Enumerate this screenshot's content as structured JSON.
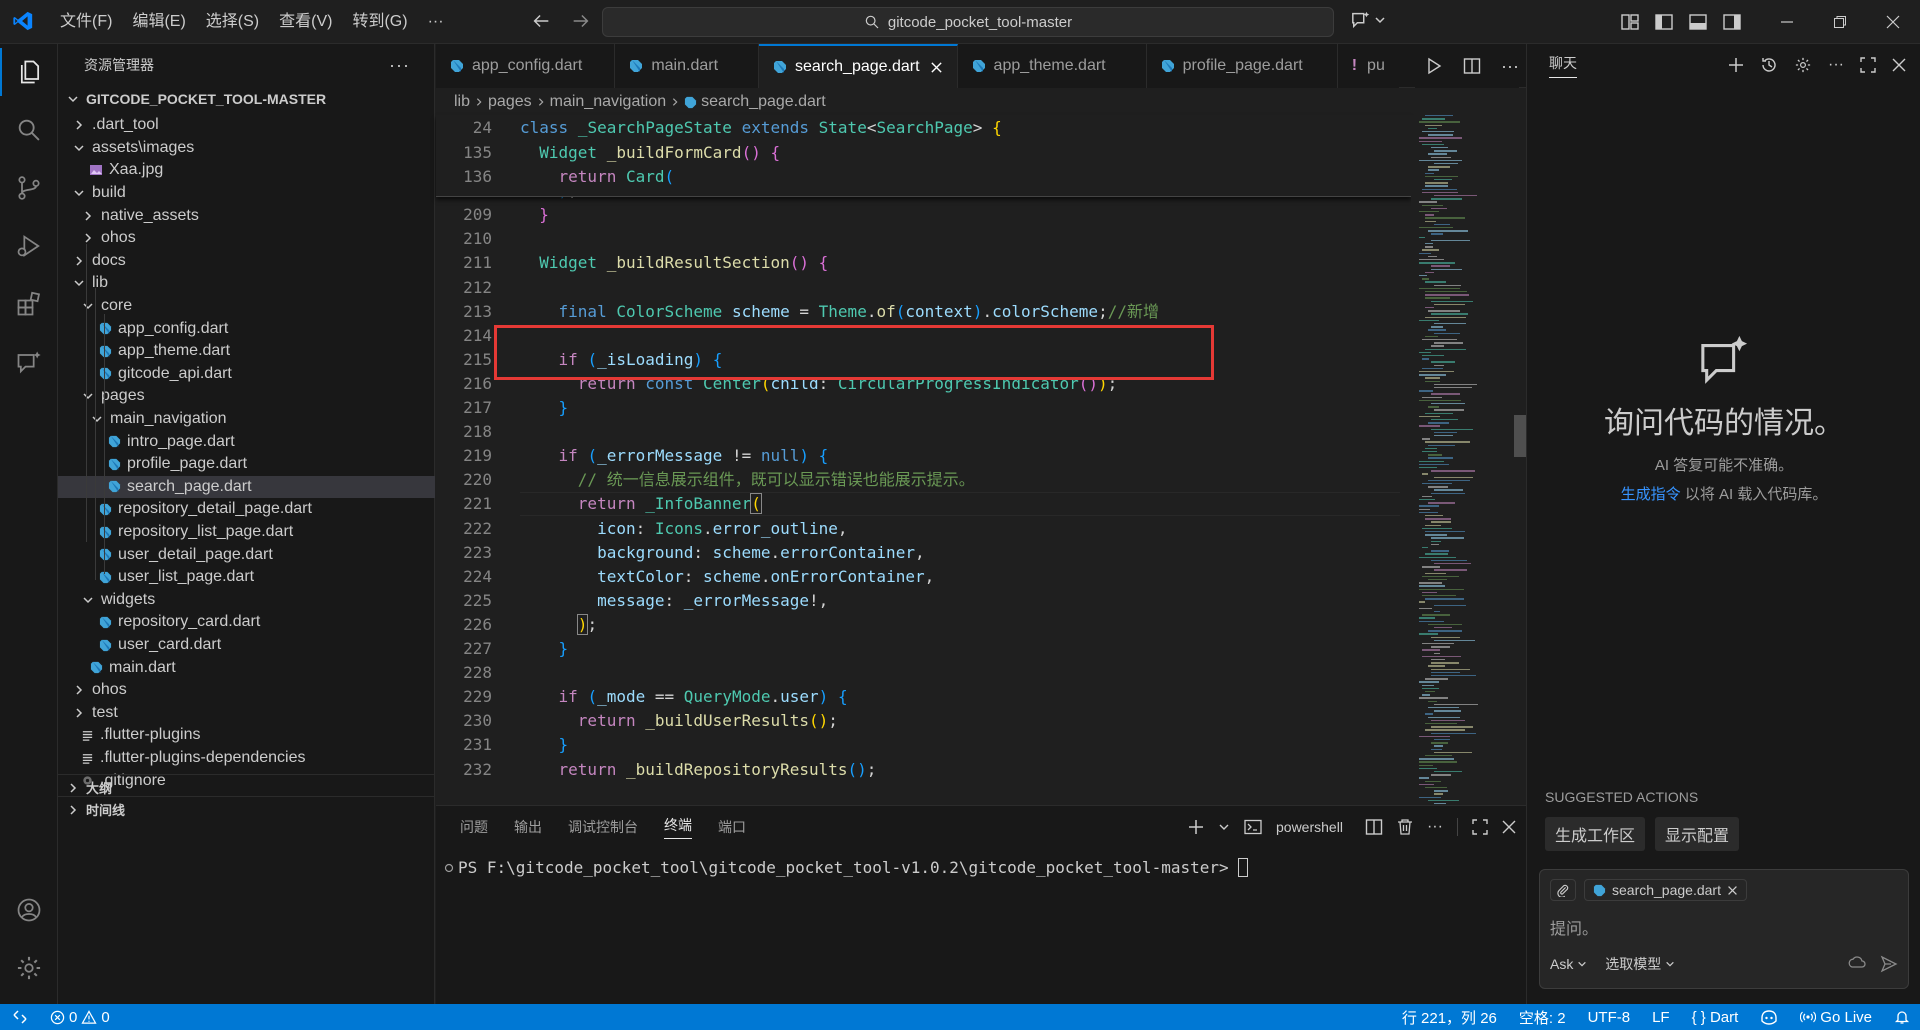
{
  "titlebar": {
    "menu": [
      "文件(F)",
      "编辑(E)",
      "选择(S)",
      "查看(V)",
      "转到(G)",
      "···"
    ],
    "search_text": "gitcode_pocket_tool-master"
  },
  "sidebar": {
    "title": "资源管理器",
    "root": "GITCODE_POCKET_TOOL-MASTER",
    "items": [
      {
        "label": ".dart_tool",
        "depth": 0,
        "type": "folder",
        "open": false
      },
      {
        "label": "assets\\images",
        "depth": 0,
        "type": "folder",
        "open": true
      },
      {
        "label": "Xaa.jpg",
        "depth": 1,
        "type": "image"
      },
      {
        "label": "build",
        "depth": 0,
        "type": "folder",
        "open": true
      },
      {
        "label": "native_assets",
        "depth": 1,
        "type": "folder",
        "open": false
      },
      {
        "label": "ohos",
        "depth": 1,
        "type": "folder",
        "open": false
      },
      {
        "label": "docs",
        "depth": 0,
        "type": "folder",
        "open": false
      },
      {
        "label": "lib",
        "depth": 0,
        "type": "folder",
        "open": true
      },
      {
        "label": "core",
        "depth": 1,
        "type": "folder",
        "open": true
      },
      {
        "label": "app_config.dart",
        "depth": 2,
        "type": "dart"
      },
      {
        "label": "app_theme.dart",
        "depth": 2,
        "type": "dart"
      },
      {
        "label": "gitcode_api.dart",
        "depth": 2,
        "type": "dart"
      },
      {
        "label": "pages",
        "depth": 1,
        "type": "folder",
        "open": true
      },
      {
        "label": "main_navigation",
        "depth": 2,
        "type": "folder",
        "open": true
      },
      {
        "label": "intro_page.dart",
        "depth": 3,
        "type": "dart"
      },
      {
        "label": "profile_page.dart",
        "depth": 3,
        "type": "dart"
      },
      {
        "label": "search_page.dart",
        "depth": 3,
        "type": "dart",
        "selected": true
      },
      {
        "label": "repository_detail_page.dart",
        "depth": 2,
        "type": "dart"
      },
      {
        "label": "repository_list_page.dart",
        "depth": 2,
        "type": "dart"
      },
      {
        "label": "user_detail_page.dart",
        "depth": 2,
        "type": "dart"
      },
      {
        "label": "user_list_page.dart",
        "depth": 2,
        "type": "dart"
      },
      {
        "label": "widgets",
        "depth": 1,
        "type": "folder",
        "open": true
      },
      {
        "label": "repository_card.dart",
        "depth": 2,
        "type": "dart"
      },
      {
        "label": "user_card.dart",
        "depth": 2,
        "type": "dart"
      },
      {
        "label": "main.dart",
        "depth": 1,
        "type": "dart"
      },
      {
        "label": "ohos",
        "depth": 0,
        "type": "folder",
        "open": false
      },
      {
        "label": "test",
        "depth": 0,
        "type": "folder",
        "open": false
      },
      {
        "label": ".flutter-plugins",
        "depth": 0,
        "type": "lines"
      },
      {
        "label": ".flutter-plugins-dependencies",
        "depth": 0,
        "type": "lines"
      },
      {
        "label": ".gitignore",
        "depth": 0,
        "type": "gear"
      }
    ],
    "outline": "大纲",
    "timeline": "时间线"
  },
  "tabs": [
    "app_config.dart",
    "main.dart",
    "search_page.dart",
    "app_theme.dart",
    "profile_page.dart",
    "pu"
  ],
  "breadcrumbs": [
    "lib",
    "pages",
    "main_navigation",
    "search_page.dart"
  ],
  "editor": {
    "sticky": [
      {
        "n": "24",
        "html": "<span class='k'>class</span> <span class='ty'>_SearchPageState</span> <span class='k'>extends</span> <span class='ty'>State</span><span class='pl'>&lt;</span><span class='ty'>SearchPage</span><span class='pl'>&gt;</span> <span class='br'>{</span>"
      },
      {
        "n": "135",
        "html": "  <span class='ty'>Widget</span> <span class='fn'>_buildFormCard</span><span class='br2'>()</span> <span class='br2'>{</span>"
      },
      {
        "n": "136",
        "html": "    <span class='kf'>return</span> <span class='ty'>Card</span><span class='br3'>(</span>"
      }
    ],
    "lines": [
      {
        "n": "207",
        "html": "      <span class='br'>)</span>,"
      },
      {
        "n": "208",
        "html": "    <span class='br3'>)</span>;"
      },
      {
        "n": "209",
        "html": "  <span class='br2'>}</span>"
      },
      {
        "n": "210",
        "html": ""
      },
      {
        "n": "211",
        "html": "  <span class='ty'>Widget</span> <span class='fn'>_buildResultSection</span><span class='br2'>()</span> <span class='br2'>{</span>"
      },
      {
        "n": "212",
        "html": ""
      },
      {
        "n": "213",
        "html": "    <span class='k'>final</span> <span class='ty'>ColorScheme</span> <span class='va'>scheme</span> = <span class='ty'>Theme</span>.<span class='fn'>of</span><span class='br3'>(</span><span class='va'>context</span><span class='br3'>)</span>.<span class='va'>colorScheme</span>;<span class='cm'>//新增</span>"
      },
      {
        "n": "214",
        "html": ""
      },
      {
        "n": "215",
        "html": "    <span class='kf'>if</span> <span class='br3'>(</span><span class='va'>_isLoading</span><span class='br3'>)</span> <span class='br3'>{</span>"
      },
      {
        "n": "216",
        "html": "      <span class='kf'>return</span> <span class='k'>const</span> <span class='ty'>Center</span><span class='br'>(</span><span class='va'>child</span>: <span class='ty'>CircularProgressIndicator</span><span class='br2'>()</span><span class='br'>)</span>;"
      },
      {
        "n": "217",
        "html": "    <span class='br3'>}</span>"
      },
      {
        "n": "218",
        "html": ""
      },
      {
        "n": "219",
        "html": "    <span class='kf'>if</span> <span class='br3'>(</span><span class='va'>_errorMessage</span> != <span class='k'>null</span><span class='br3'>)</span> <span class='br3'>{</span>"
      },
      {
        "n": "220",
        "html": "      <span class='cm'>// 统一信息展示组件，既可以显示错误也能展示提示。</span>"
      },
      {
        "n": "221",
        "html": "      <span class='kf'>return</span> <span class='ty'>_InfoBanner</span><span class='br' style='outline:1px solid #888'>(</span>"
      },
      {
        "n": "222",
        "html": "        <span class='va'>icon</span>: <span class='ty'>Icons</span>.<span class='va'>error_outline</span>,"
      },
      {
        "n": "223",
        "html": "        <span class='va'>background</span>: <span class='va'>scheme</span>.<span class='va'>errorContainer</span>,"
      },
      {
        "n": "224",
        "html": "        <span class='va'>textColor</span>: <span class='va'>scheme</span>.<span class='va'>onErrorContainer</span>,"
      },
      {
        "n": "225",
        "html": "        <span class='va'>message</span>: <span class='va'>_errorMessage</span>!,"
      },
      {
        "n": "226",
        "html": "      <span class='br' style='outline:1px solid #888'>)</span>;"
      },
      {
        "n": "227",
        "html": "    <span class='br3'>}</span>"
      },
      {
        "n": "228",
        "html": ""
      },
      {
        "n": "229",
        "html": "    <span class='kf'>if</span> <span class='br3'>(</span><span class='va'>_mode</span> == <span class='ty'>QueryMode</span>.<span class='va'>user</span><span class='br3'>)</span> <span class='br3'>{</span>"
      },
      {
        "n": "230",
        "html": "      <span class='kf'>return</span> <span class='fn'>_buildUserResults</span><span class='br'>()</span>;"
      },
      {
        "n": "231",
        "html": "    <span class='br3'>}</span>"
      },
      {
        "n": "232",
        "html": "    <span class='kf'>return</span> <span class='fn'>_buildRepositoryResults</span><span class='br3'>()</span>;"
      }
    ]
  },
  "panel": {
    "tabs": [
      "问题",
      "输出",
      "调试控制台",
      "终端",
      "端口"
    ],
    "active_tab": "终端",
    "shell": "powershell",
    "prompt": "PS F:\\gitcode_pocket_tool\\gitcode_pocket_tool-v1.0.2\\gitcode_pocket_tool-master> "
  },
  "chat": {
    "title": "聊天",
    "heading": "询问代码的情况。",
    "disclaimer": "AI 答复可能不准确。",
    "link": "生成指令",
    "link_suffix": " 以将 AI 载入代码库。",
    "suggested_label": "SUGGESTED ACTIONS",
    "suggestions": [
      "生成工作区",
      "显示配置"
    ],
    "attachment": "search_page.dart",
    "placeholder": "提问。",
    "mode": "Ask",
    "model": "选取模型"
  },
  "status": {
    "errors": "0",
    "warnings": "0",
    "position": "行 221，列 26",
    "spaces": "空格: 2",
    "encoding": "UTF-8",
    "eol": "LF",
    "language": "Dart",
    "golive": "Go Live"
  },
  "colors": {
    "accent": "#0078d4",
    "highlight_box": "#e53935",
    "dart": "#40a4d8"
  }
}
